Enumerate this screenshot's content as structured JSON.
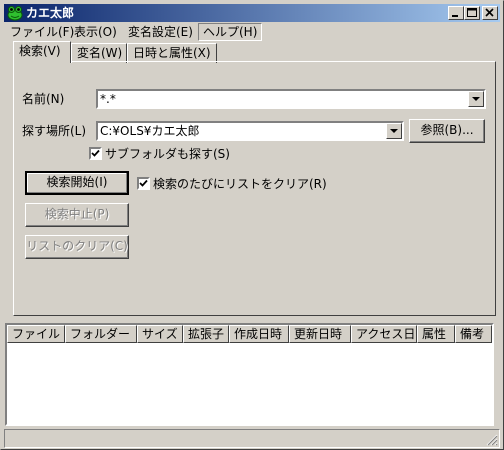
{
  "window": {
    "title": "カエ太郎",
    "app_icon": "frog-icon",
    "controls": [
      "minimize-icon",
      "maximize-icon",
      "close-icon"
    ]
  },
  "menu": [
    "ファイル(F)",
    "表示(O)",
    "変名設定(E)",
    "ヘルプ(H)"
  ],
  "tabs": [
    "検索(V)",
    "変名(W)",
    "日時と属性(X)"
  ],
  "search": {
    "name_label": "名前(N)",
    "name_value": "*.*",
    "location_label": "探す場所(L)",
    "location_value": "C:¥OLS¥カエ太郎",
    "browse_button": "参照(B)...",
    "subfolder_label": "サブフォルダも探す(S)",
    "subfolder_checked": true,
    "start_button": "検索開始(I)",
    "clear_each_label": "検索のたびにリストをクリア(R)",
    "clear_each_checked": true,
    "stop_button": "検索中止(P)",
    "clear_list_button": "リストのクリア(C)"
  },
  "columns": [
    "ファイル",
    "フォルダー",
    "サイズ",
    "拡張子",
    "作成日時",
    "更新日時",
    "アクセス日",
    "属性",
    "備考"
  ],
  "status_text": ""
}
